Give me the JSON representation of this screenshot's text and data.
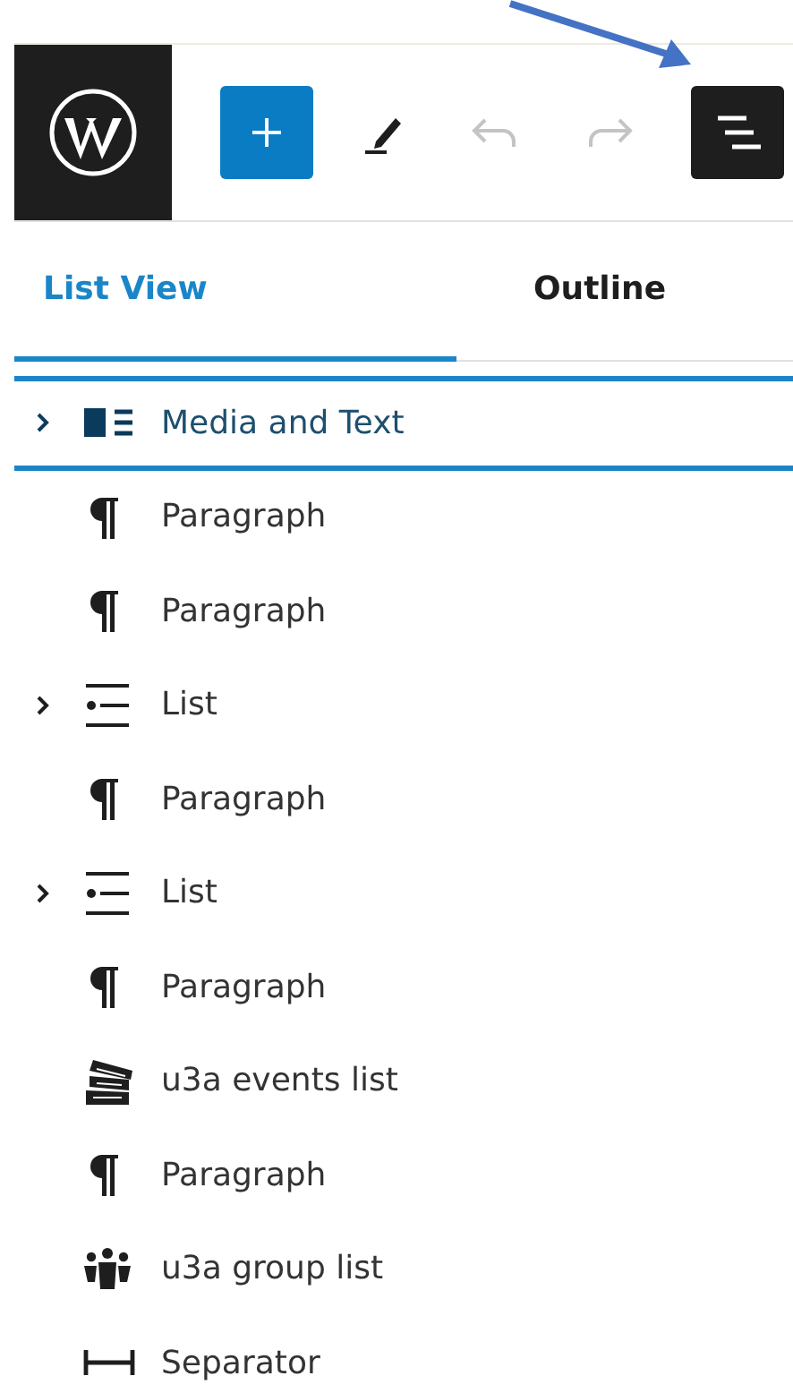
{
  "toolbar": [
    {
      "kind": "logo"
    },
    {
      "kind": "add",
      "selected": false,
      "disabled": false
    },
    {
      "kind": "edit",
      "selected": false,
      "disabled": false
    },
    {
      "kind": "undo",
      "selected": false,
      "disabled": true
    },
    {
      "kind": "redo",
      "selected": false,
      "disabled": true
    },
    {
      "kind": "listview",
      "selected": true,
      "disabled": false
    }
  ],
  "tabs": [
    {
      "label": "List View",
      "selected": true
    },
    {
      "label": "Outline",
      "selected": false
    }
  ],
  "items": [
    {
      "kind": "media",
      "label": "Media and Text",
      "expandable": true,
      "selected": true
    },
    {
      "kind": "paragraph",
      "label": "Paragraph",
      "expandable": false,
      "selected": false
    },
    {
      "kind": "paragraph",
      "label": "Paragraph",
      "expandable": false,
      "selected": false
    },
    {
      "kind": "list",
      "label": "List",
      "expandable": true,
      "selected": false
    },
    {
      "kind": "paragraph",
      "label": "Paragraph",
      "expandable": false,
      "selected": false
    },
    {
      "kind": "list",
      "label": "List",
      "expandable": true,
      "selected": false
    },
    {
      "kind": "paragraph",
      "label": "Paragraph",
      "expandable": false,
      "selected": false
    },
    {
      "kind": "events",
      "label": "u3a events list",
      "expandable": false,
      "selected": false
    },
    {
      "kind": "paragraph",
      "label": "Paragraph",
      "expandable": false,
      "selected": false
    },
    {
      "kind": "group",
      "label": "u3a group list",
      "expandable": false,
      "selected": false
    },
    {
      "kind": "separator",
      "label": "Separator",
      "expandable": false,
      "selected": false
    }
  ]
}
